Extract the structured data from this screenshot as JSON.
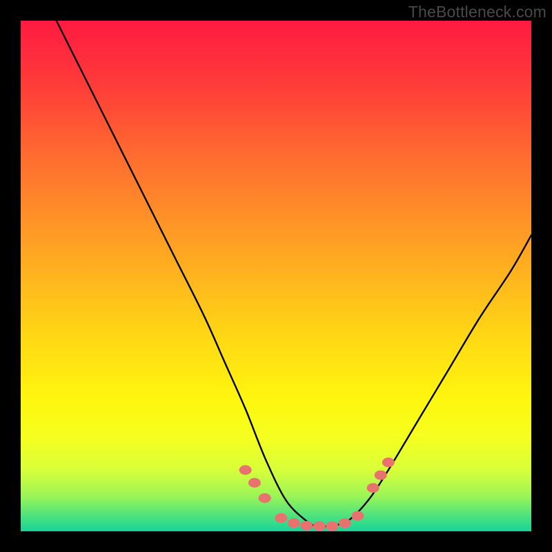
{
  "watermark": "TheBottleneck.com",
  "chart_data": {
    "type": "line",
    "title": "",
    "xlabel": "",
    "ylabel": "",
    "xlim": [
      0,
      100
    ],
    "ylim": [
      0,
      100
    ],
    "grid": false,
    "legend_position": "none",
    "series": [
      {
        "name": "bottleneck-curve",
        "x": [
          7,
          12,
          18,
          24,
          30,
          36,
          40,
          44,
          48,
          52,
          56,
          58,
          60,
          64,
          68,
          72,
          78,
          84,
          90,
          96,
          100
        ],
        "y": [
          100,
          90,
          78,
          66,
          54,
          42,
          33,
          24,
          14,
          6,
          2,
          1,
          1,
          2,
          6,
          12,
          22,
          32,
          42,
          51,
          58
        ]
      }
    ],
    "markers": [
      {
        "name": "dot-left-upper",
        "x": 44.0,
        "y": 12.0
      },
      {
        "name": "dot-left-mid",
        "x": 45.8,
        "y": 9.5
      },
      {
        "name": "dot-left-lower",
        "x": 47.8,
        "y": 6.5
      },
      {
        "name": "dot-valley-l1",
        "x": 51.0,
        "y": 2.6
      },
      {
        "name": "dot-valley-l2",
        "x": 53.5,
        "y": 1.6
      },
      {
        "name": "dot-valley-c1",
        "x": 56.0,
        "y": 1.1
      },
      {
        "name": "dot-valley-c2",
        "x": 58.5,
        "y": 1.0
      },
      {
        "name": "dot-valley-c3",
        "x": 61.0,
        "y": 1.0
      },
      {
        "name": "dot-valley-r1",
        "x": 63.5,
        "y": 1.6
      },
      {
        "name": "dot-valley-r2",
        "x": 66.0,
        "y": 3.0
      },
      {
        "name": "dot-right-lower",
        "x": 69.0,
        "y": 8.5
      },
      {
        "name": "dot-right-mid",
        "x": 70.5,
        "y": 11.0
      },
      {
        "name": "dot-right-upper",
        "x": 72.0,
        "y": 13.5
      }
    ],
    "marker_style": {
      "radius_px": 9,
      "fill": "#e8736e",
      "stroke": "#c95550"
    }
  }
}
